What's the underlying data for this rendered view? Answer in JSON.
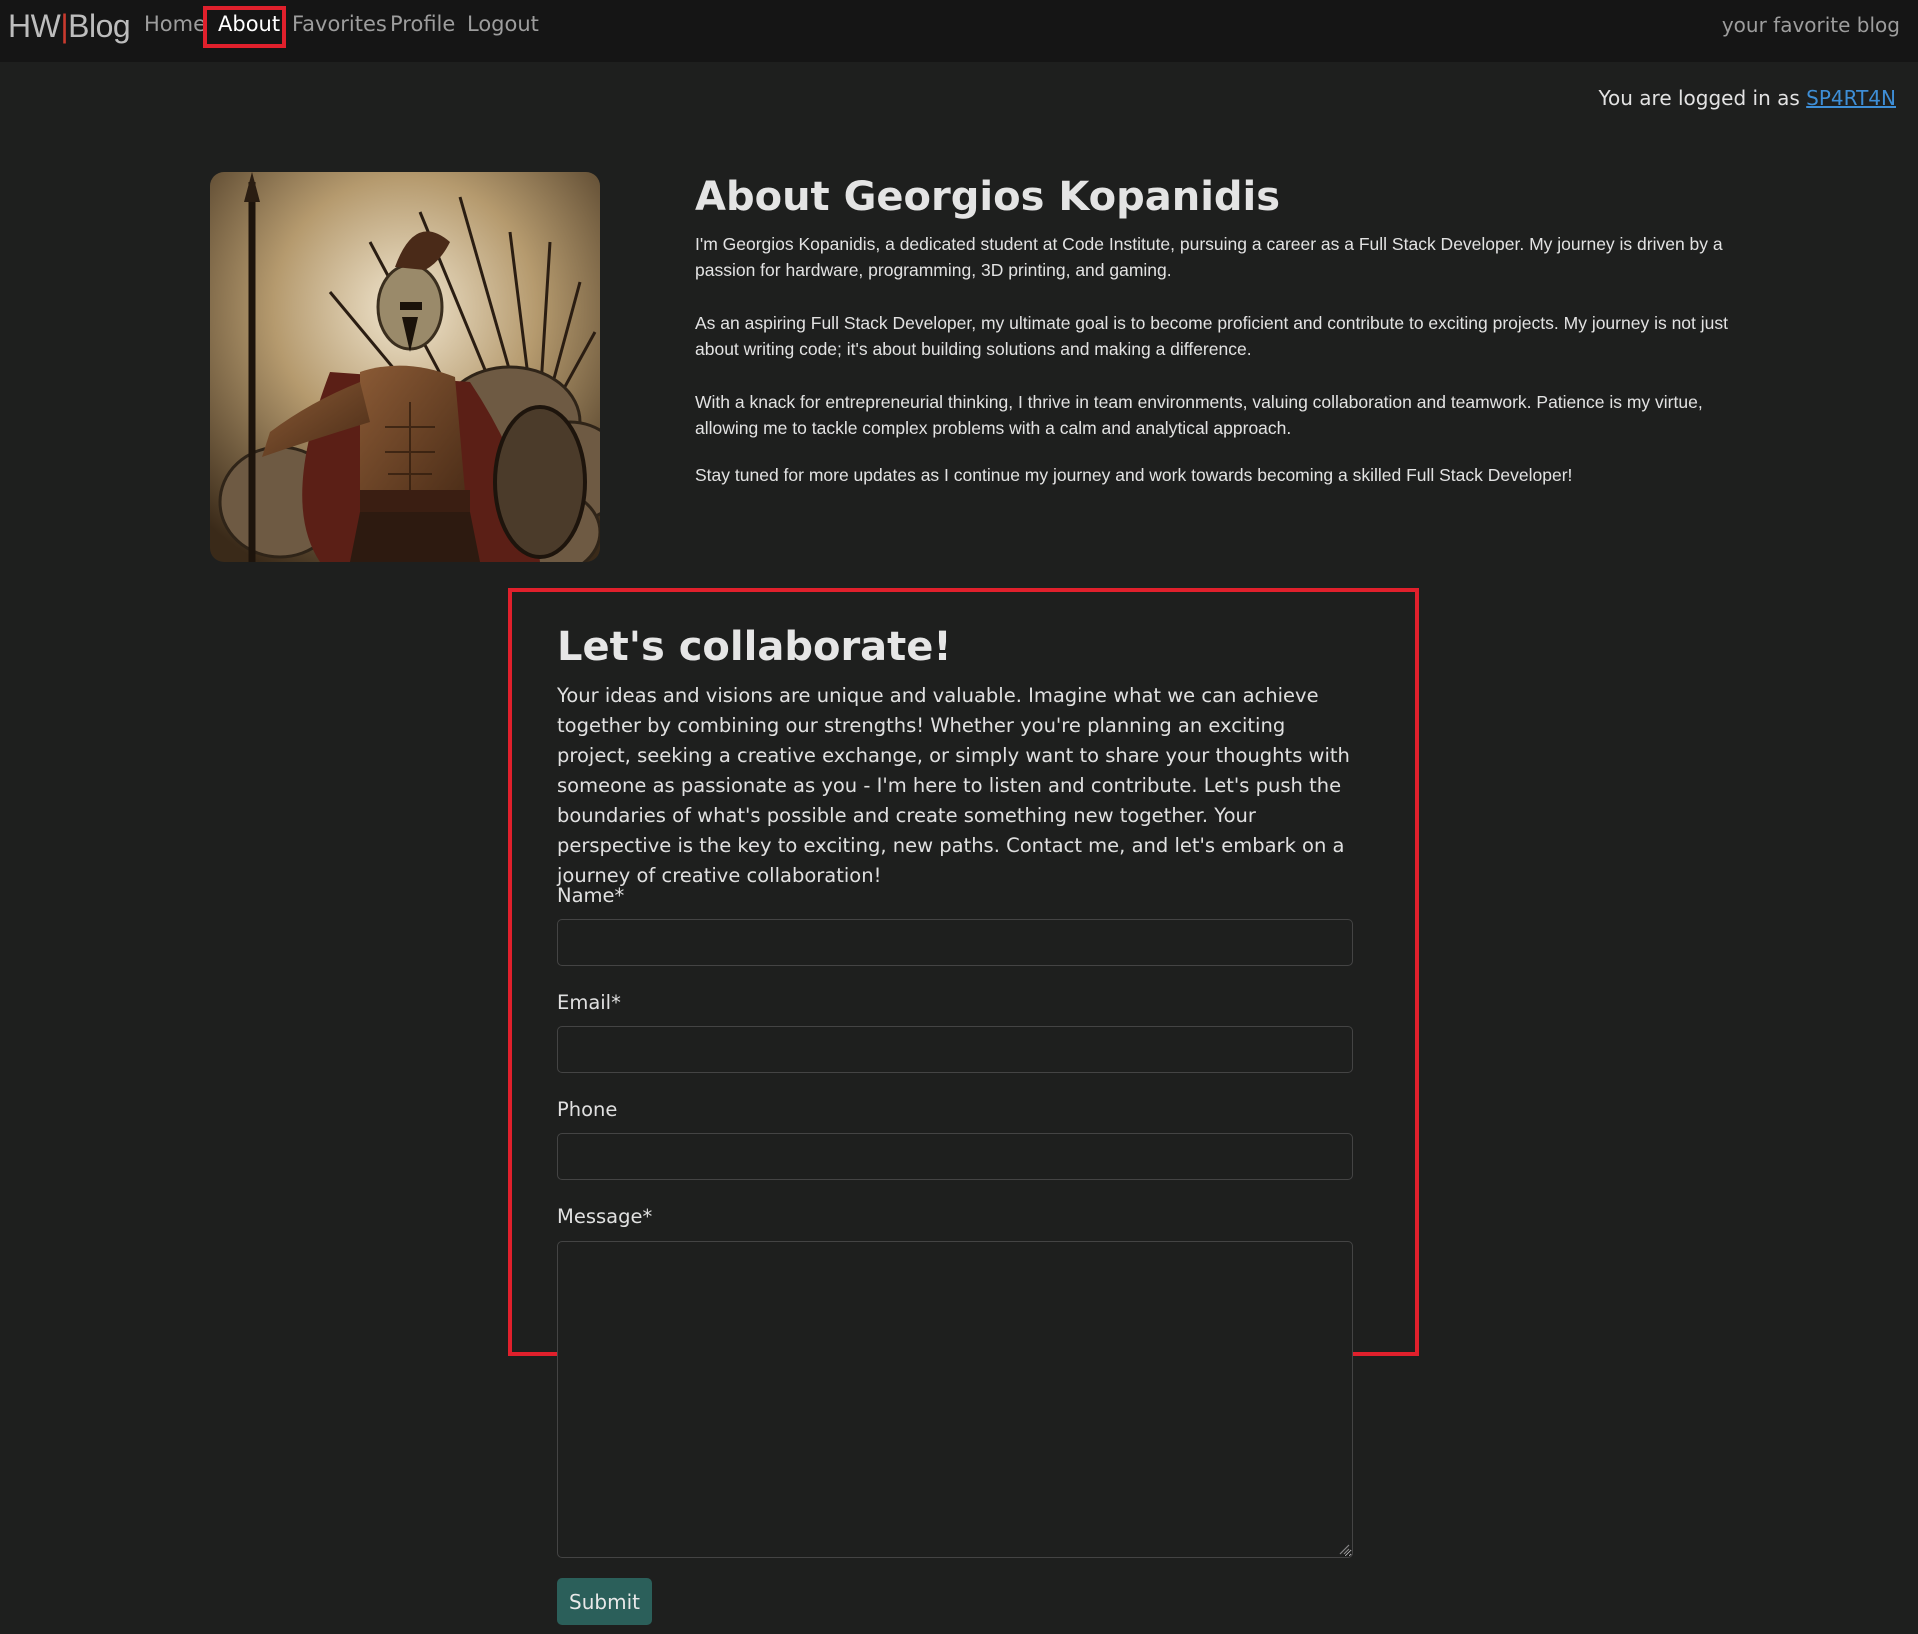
{
  "nav": {
    "brand_left": "HW",
    "brand_sep": "|",
    "brand_right": "Blog",
    "items": [
      {
        "label": "Home"
      },
      {
        "label": "About"
      },
      {
        "label": "Favorites"
      },
      {
        "label": "Profile"
      },
      {
        "label": "Logout"
      }
    ],
    "active": "About",
    "tagline": "your favorite blog"
  },
  "user": {
    "prefix": "You are logged in as",
    "username": "SP4RT4N"
  },
  "about": {
    "title": "About Georgios Kopanidis",
    "paragraphs": [
      "I'm Georgios Kopanidis, a dedicated student at Code Institute, pursuing a career as a Full Stack Developer. My journey is driven by a passion for hardware, programming, 3D printing, and gaming.",
      "As an aspiring Full Stack Developer, my ultimate goal is to become proficient and contribute to exciting projects. My journey is not just about writing code; it's about building solutions and making a difference.",
      "With a knack for entrepreneurial thinking, I thrive in team environments, valuing collaboration and teamwork. Patience is my virtue, allowing me to tackle complex problems with a calm and analytical approach.",
      "Stay tuned for more updates as I continue my journey and work towards becoming a skilled Full Stack Developer!"
    ]
  },
  "collab": {
    "title": "Let's collaborate!",
    "text": "Your ideas and visions are unique and valuable. Imagine what we can achieve together by combining our strengths! Whether you're planning an exciting project, seeking a creative exchange, or simply want to share your thoughts with someone as passionate as you - I'm here to listen and contribute. Let's push the boundaries of what's possible and create something new together. Your perspective is the key to exciting, new paths. Contact me, and let's embark on a journey of creative collaboration!",
    "fields": {
      "name_label": "Name*",
      "name_value": "",
      "email_label": "Email*",
      "email_value": "",
      "phone_label": "Phone",
      "phone_value": "",
      "message_label": "Message*",
      "message_value": ""
    },
    "submit_label": "Submit"
  },
  "colors": {
    "background": "#1e1f1e",
    "navbar": "#151515",
    "highlight": "#e0202c",
    "link": "#3e8ed6",
    "submit": "#2b5f5a"
  }
}
